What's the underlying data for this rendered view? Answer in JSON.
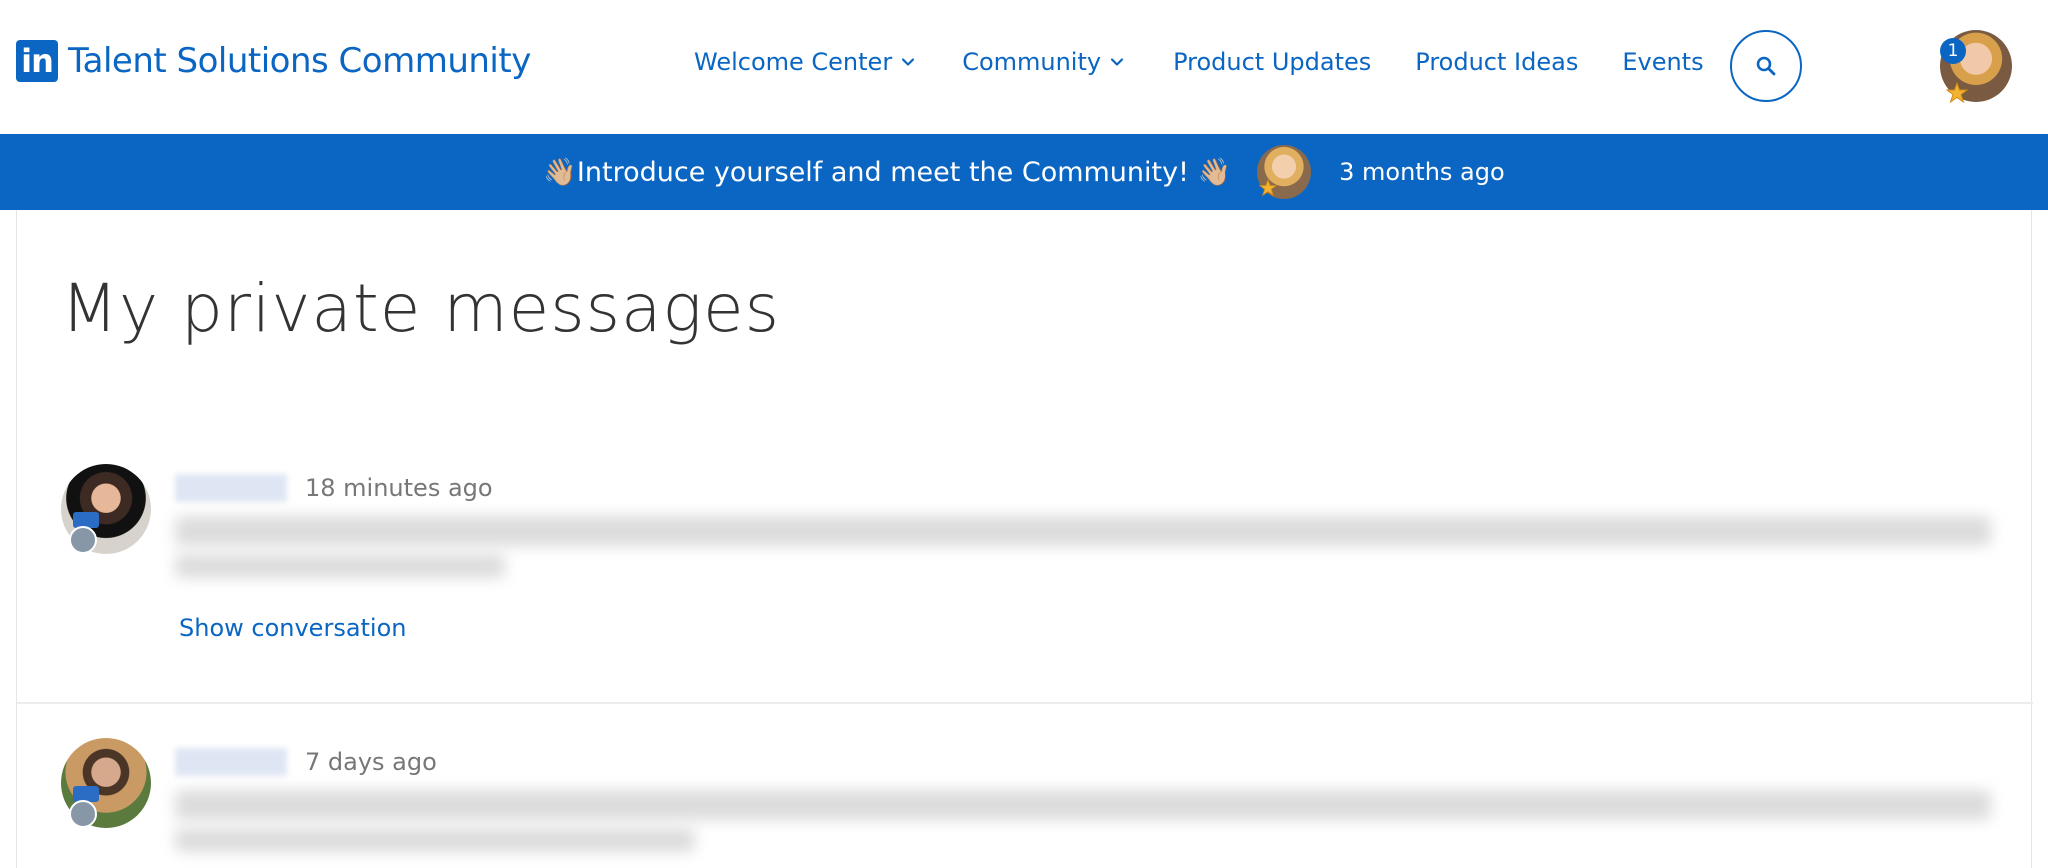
{
  "header": {
    "logo_mark": "in",
    "logo_text": "Talent Solutions Community",
    "nav": [
      {
        "label": "Welcome Center"
      },
      {
        "label": "Community"
      },
      {
        "label": "Product Updates"
      },
      {
        "label": "Product Ideas"
      },
      {
        "label": "Events"
      }
    ],
    "notification_count": "1"
  },
  "banner": {
    "title": "👋🏼Introduce yourself and meet the Community! 👋🏼",
    "time": "3 months ago"
  },
  "main": {
    "title": "My private messages",
    "messages": [
      {
        "time": "18 minutes ago",
        "action": "Show conversation"
      },
      {
        "time": "7 days ago"
      }
    ]
  },
  "colors": {
    "brand": "#0a66c2",
    "banner_bg": "#0a66c2",
    "text": "#333333",
    "muted": "#777777"
  }
}
